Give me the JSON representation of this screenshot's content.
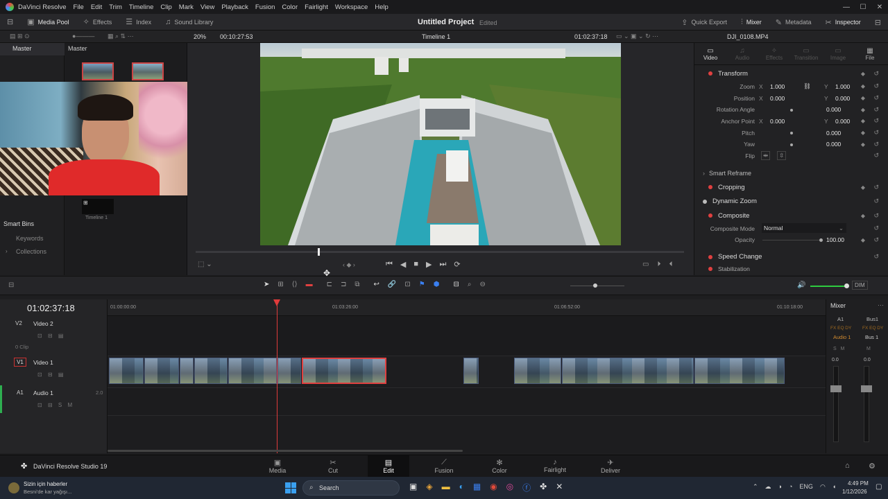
{
  "menu": [
    "DaVinci Resolve",
    "File",
    "Edit",
    "Trim",
    "Timeline",
    "Clip",
    "Mark",
    "View",
    "Playback",
    "Fusion",
    "Color",
    "Fairlight",
    "Workspace",
    "Help"
  ],
  "toolbar": {
    "media_pool": "Media Pool",
    "effects": "Effects",
    "index": "Index",
    "sound_library": "Sound Library",
    "project_title": "Untitled Project",
    "edited": "Edited",
    "quick_export": "Quick Export",
    "mixer": "Mixer",
    "metadata": "Metadata",
    "inspector": "Inspector"
  },
  "subbar": {
    "zoom": "20%",
    "source_tc": "00:10:27:53",
    "timeline_name": "Timeline 1",
    "record_tc": "01:02:37:18",
    "clip_name": "DJI_0108.MP4"
  },
  "media_pool": {
    "master_left": "Master",
    "master_right": "Master",
    "smart_bins": "Smart Bins",
    "keywords": "Keywords",
    "collections": "Collections",
    "timeline_item": "Timeline 1"
  },
  "inspector": {
    "tabs": [
      "Video",
      "Audio",
      "Effects",
      "Transition",
      "Image",
      "File"
    ],
    "transform": "Transform",
    "zoom_label": "Zoom",
    "zoom_x": "1.000",
    "zoom_y": "1.000",
    "position_label": "Position",
    "pos_x": "0.000",
    "pos_y": "0.000",
    "rotation_label": "Rotation Angle",
    "rotation": "0.000",
    "anchor_label": "Anchor Point",
    "anchor_x": "0.000",
    "anchor_y": "0.000",
    "pitch_label": "Pitch",
    "pitch": "0.000",
    "yaw_label": "Yaw",
    "yaw": "0.000",
    "flip_label": "Flip",
    "smart_reframe": "Smart Reframe",
    "cropping": "Cropping",
    "dynamic_zoom": "Dynamic Zoom",
    "composite": "Composite",
    "composite_mode_label": "Composite Mode",
    "composite_mode": "Normal",
    "opacity_label": "Opacity",
    "opacity": "100.00",
    "speed_change": "Speed Change",
    "stabilization": "Stabilization"
  },
  "timeline": {
    "timecode": "01:02:37:18",
    "ruler": [
      "01:00:00:00",
      "01:03:26:00",
      "01:06:52:00",
      "01:10:18:00"
    ],
    "v2_id": "V2",
    "v2_name": "Video 2",
    "v2_clips": "0 Clip",
    "v1_id": "V1",
    "v1_name": "Video 1",
    "a1_id": "A1",
    "a1_name": "Audio 1",
    "a1_level": "2.0"
  },
  "mixer": {
    "title": "Mixer",
    "a1": "A1",
    "bus1": "Bus1",
    "audio1": "Audio 1",
    "bus1b": "Bus 1",
    "left_level": "0.0",
    "right_level": "0.0",
    "dim": "DIM"
  },
  "pages": {
    "brand": "DaVinci Resolve Studio 19",
    "items": [
      "Media",
      "Cut",
      "Edit",
      "Fusion",
      "Color",
      "Fairlight",
      "Deliver"
    ]
  },
  "taskbar": {
    "news_title": "Sizin için haberler",
    "news_sub": "Besni'de kar yağışı...",
    "search": "Search",
    "lang": "ENG",
    "time": "4:49 PM",
    "date": "1/12/2026"
  },
  "colors": {
    "accent": "#e04040",
    "playhead": "#e03b3b",
    "active_page": "#0f0f10"
  }
}
